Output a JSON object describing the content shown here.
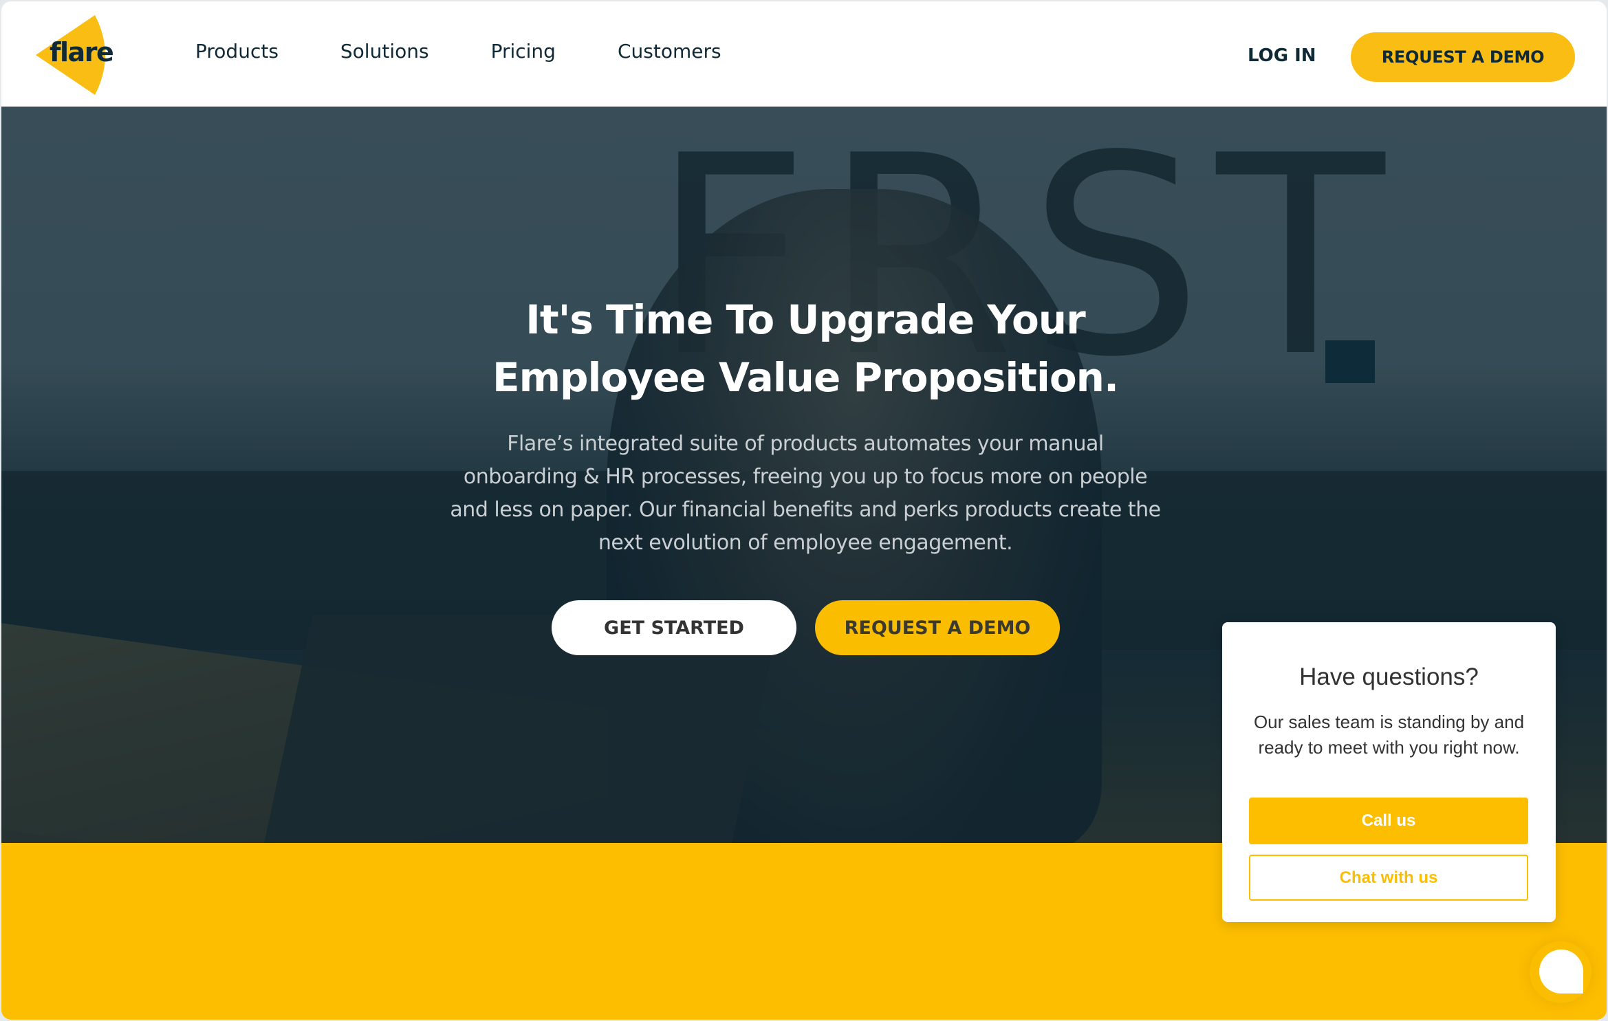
{
  "brand": {
    "name": "flare",
    "accent_color": "#fbbd00",
    "text_color": "#0f2a36"
  },
  "header": {
    "nav": [
      {
        "label": "Products"
      },
      {
        "label": "Solutions"
      },
      {
        "label": "Pricing"
      },
      {
        "label": "Customers"
      }
    ],
    "login_label": "LOG IN",
    "demo_label": "REQUEST A DEMO"
  },
  "hero": {
    "background_wall_text": "FRST",
    "title_line1": "It's Time To Upgrade Your",
    "title_line2": "Employee Value Proposition.",
    "subtitle": "Flare’s integrated suite of products automates your manual onboarding & HR processes, freeing you up to focus more on people and less on paper. Our financial benefits and perks products create the next evolution of employee engagement.",
    "get_started_label": "GET STARTED",
    "demo_label": "REQUEST A DEMO"
  },
  "chat_popup": {
    "title": "Have questions?",
    "body": "Our sales team is standing by and ready to meet with you right now.",
    "call_label": "Call us",
    "chat_label": "Chat with us"
  },
  "chat_launcher": {
    "icon": "chat-bubble-icon"
  }
}
